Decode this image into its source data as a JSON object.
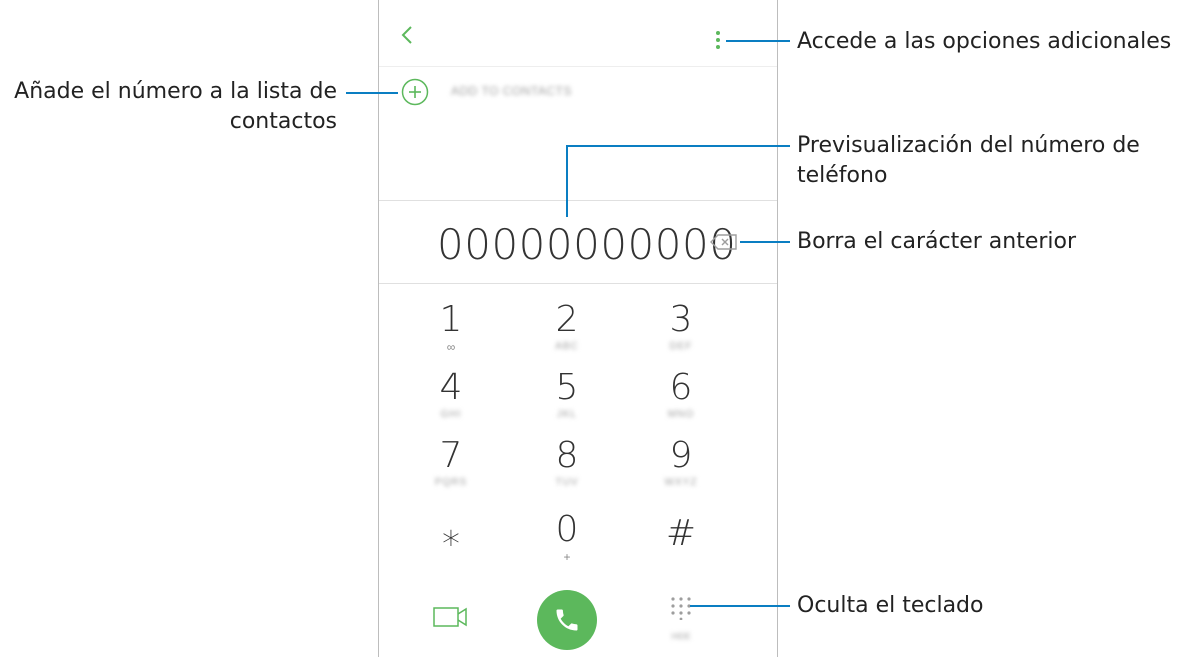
{
  "screen": {
    "add_to_contacts_label": "ADD TO CONTACTS",
    "phone_number": "00000000000",
    "keys": [
      {
        "digit": "1",
        "sub": "∞",
        "sub_kind": "voicemail"
      },
      {
        "digit": "2",
        "sub": "ABC",
        "sub_kind": "letters"
      },
      {
        "digit": "3",
        "sub": "DEF",
        "sub_kind": "letters"
      },
      {
        "digit": "4",
        "sub": "GHI",
        "sub_kind": "letters"
      },
      {
        "digit": "5",
        "sub": "JKL",
        "sub_kind": "letters"
      },
      {
        "digit": "6",
        "sub": "MNO",
        "sub_kind": "letters"
      },
      {
        "digit": "7",
        "sub": "PQRS",
        "sub_kind": "letters"
      },
      {
        "digit": "8",
        "sub": "TUV",
        "sub_kind": "letters"
      },
      {
        "digit": "9",
        "sub": "WXYZ",
        "sub_kind": "letters"
      },
      {
        "digit": "⁎",
        "sub": "",
        "sub_kind": "none"
      },
      {
        "digit": "0",
        "sub": "+",
        "sub_kind": "plus"
      },
      {
        "digit": "#",
        "sub": "",
        "sub_kind": "none"
      }
    ],
    "hide_keypad_sub": "HIDE",
    "accent_color": "#5cb85c",
    "icons": [
      "back-arrow-icon",
      "more-options-icon",
      "add-contact-icon",
      "backspace-icon",
      "video-call-icon",
      "phone-icon",
      "dialpad-icon"
    ]
  },
  "callouts": {
    "more_options": "Accede a las opciones adicionales",
    "add_contact_line1": "Añade el número a la lista de",
    "add_contact_line2": "contactos",
    "preview_line1": "Previsualización del número de",
    "preview_line2": "teléfono",
    "delete_char": "Borra el carácter anterior",
    "hide_keypad": "Oculta el teclado",
    "line_color": "#0a7ec2"
  }
}
